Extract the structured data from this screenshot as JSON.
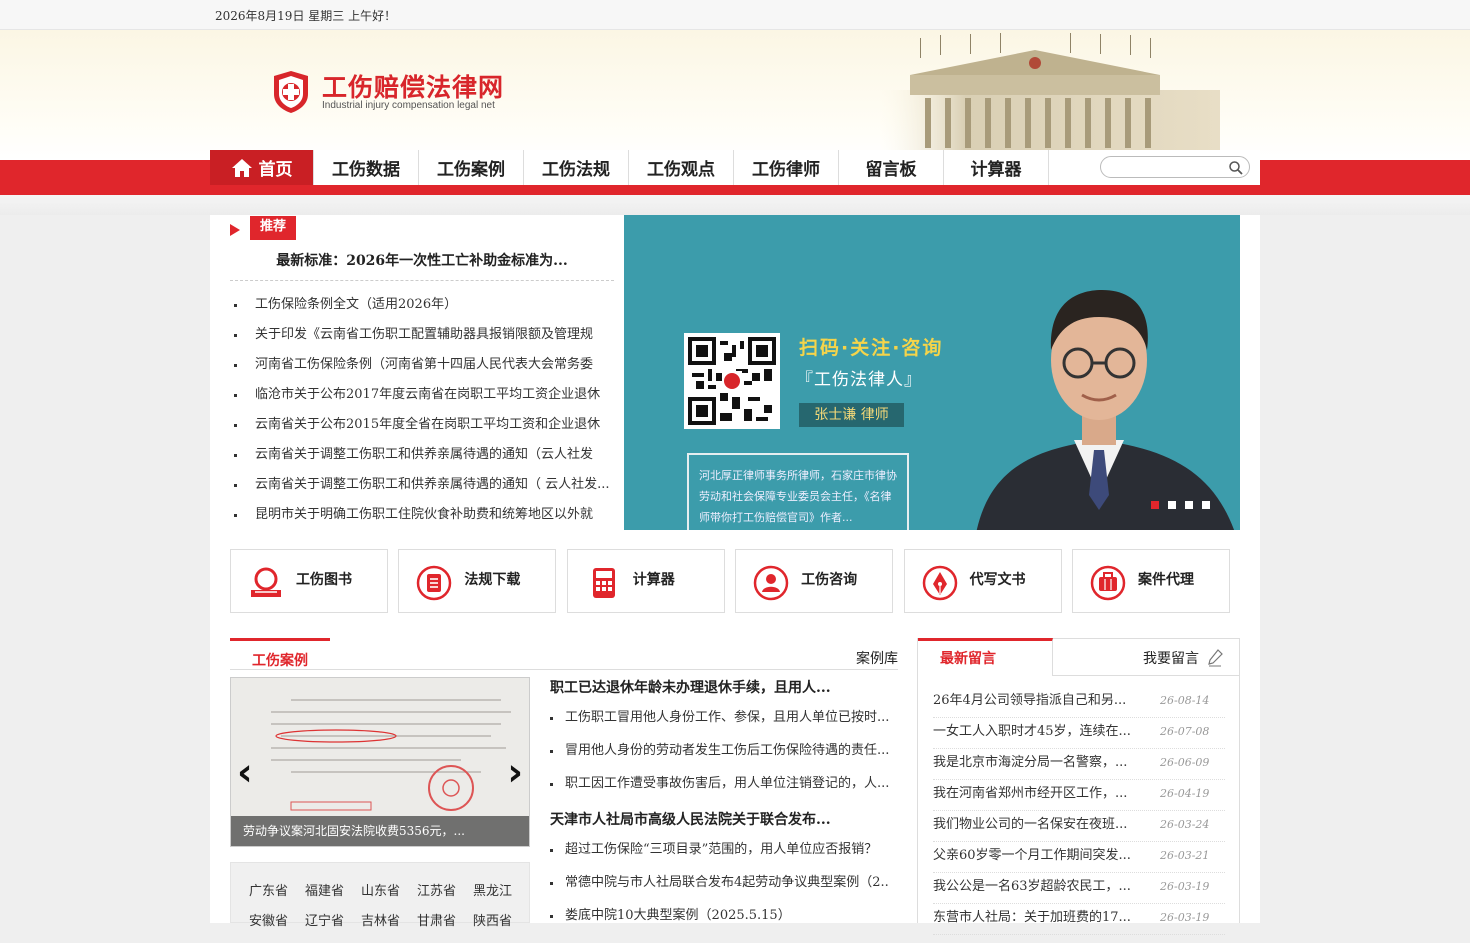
{
  "topbar": {
    "date": "2026年8月19日 星期三 上午好！"
  },
  "logo": {
    "name": "工伤赔偿法律网",
    "subtitle": "Industrial injury compensation legal net"
  },
  "nav": {
    "items": [
      "首页",
      "工伤数据",
      "工伤案例",
      "工伤法规",
      "工伤观点",
      "工伤律师",
      "留言板",
      "计算器"
    ],
    "active_index": 0
  },
  "search": {
    "placeholder": "",
    "icon": "search-icon"
  },
  "recommend": {
    "tag": "推荐",
    "headline": "最新标准：2026年一次性工亡补助金标准为...",
    "items": [
      "工伤保险条例全文（适用2026年）",
      "关于印发《云南省工伤职工配置辅助器具报销限额及管理规",
      "河南省工伤保险条例（河南省第十四届人民代表大会常务委",
      "临沧市关于公布2017年度云南省在岗职工平均工资企业退休",
      "云南省关于公布2015年度全省在岗职工平均工资和企业退休",
      "云南省关于调整工伤职工和供养亲属待遇的通知（云人社发",
      "云南省关于调整工伤职工和供养亲属待遇的通知（ 云人社发...",
      "昆明市关于明确工伤职工住院伙食补助费和统筹地区以外就"
    ]
  },
  "banner": {
    "headline": "扫码·关注·咨询",
    "account": "『工伤法律人』",
    "lawyer": "张士谦  律师",
    "bio": "河北厚正律师事务所律师，石家庄市律协劳动和社会保障专业委员会主任，《名律师带你打工伤赔偿官司》作者...",
    "slide_count": 4,
    "active_slide": 0
  },
  "services": [
    {
      "label": "工伤图书",
      "icon": "book-icon"
    },
    {
      "label": "法规下载",
      "icon": "document-icon"
    },
    {
      "label": "计算器",
      "icon": "calculator-icon"
    },
    {
      "label": "工伤咨询",
      "icon": "consult-icon"
    },
    {
      "label": "代写文书",
      "icon": "pen-icon"
    },
    {
      "label": "案件代理",
      "icon": "briefcase-icon"
    }
  ],
  "cases": {
    "tab": "工伤案例",
    "more": "案例库",
    "slide_caption": "劳动争议案河北固安法院收费5356元，...",
    "group1_title": "职工已达退休年龄未办理退休手续，且用人...",
    "group1_items": [
      "工伤职工冒用他人身份工作、参保，且用人单位已按时...",
      "冒用他人身份的劳动者发生工伤后工伤保险待遇的责任...",
      "职工因工作遭受事故伤害后，用人单位注销登记的，人..."
    ],
    "group2_title": "天津市人社局市高级人民法院关于联合发布...",
    "group2_items": [
      "超过工伤保险“三项目录”范围的，用人单位应否报销？",
      "常德中院与市人社局联合发布4起劳动争议典型案例（2...",
      "娄底中院10大典型案例（2025.5.15）"
    ],
    "provinces_row1": [
      "广东省",
      "福建省",
      "山东省",
      "江苏省",
      "黑龙江"
    ],
    "provinces_row2": [
      "安徽省",
      "辽宁省",
      "吉林省",
      "甘肃省",
      "陕西省"
    ]
  },
  "messages": {
    "tab": "最新留言",
    "more": "我要留言",
    "items": [
      {
        "title": "26年4月公司领导指派自己和另...",
        "date": "26-08-14"
      },
      {
        "title": "一女工人入职时才45岁，连续在...",
        "date": "26-07-08"
      },
      {
        "title": "我是北京市海淀分局一名警察，...",
        "date": "26-06-09"
      },
      {
        "title": "我在河南省郑州市经开区工作，...",
        "date": "26-04-19"
      },
      {
        "title": "我们物业公司的一名保安在夜班...",
        "date": "26-03-24"
      },
      {
        "title": "父亲60岁零一个月工作期间突发...",
        "date": "26-03-21"
      },
      {
        "title": "我公公是一名63岁超龄农民工，...",
        "date": "26-03-19"
      },
      {
        "title": "东营市人社局：关于加班费的17...",
        "date": "26-03-19"
      }
    ]
  },
  "colors": {
    "brand_red": "#e0262c",
    "dark_red": "#c91f24",
    "banner_teal": "#3c9cab",
    "gold_text": "#f5d44a"
  }
}
